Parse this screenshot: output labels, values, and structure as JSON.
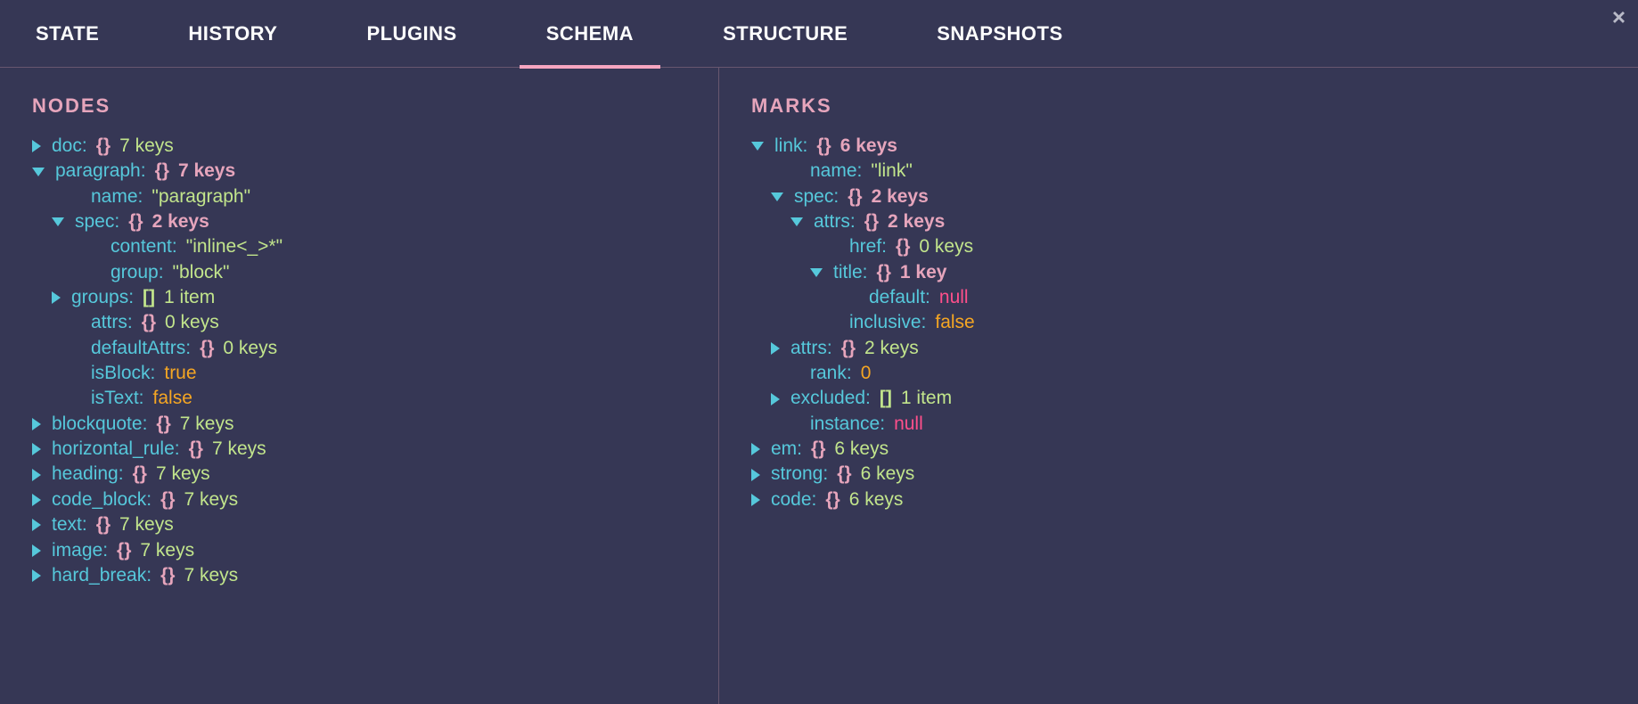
{
  "tabs": {
    "state": "STATE",
    "history": "HISTORY",
    "plugins": "PLUGINS",
    "schema": "SCHEMA",
    "structure": "STRUCTURE",
    "snapshots": "SNAPSHOTS"
  },
  "sections": {
    "nodes_title": "NODES",
    "marks_title": "MARKS"
  },
  "nodes": {
    "doc": {
      "key": "doc:",
      "brace": "{}",
      "count": "7 keys"
    },
    "paragraph": {
      "key": "paragraph:",
      "brace": "{}",
      "count": "7 keys",
      "name_key": "name:",
      "name_val": "\"paragraph\"",
      "spec": {
        "key": "spec:",
        "brace": "{}",
        "count": "2 keys",
        "content_key": "content:",
        "content_val": "\"inline<_>*\"",
        "group_key": "group:",
        "group_val": "\"block\""
      },
      "groups": {
        "key": "groups:",
        "bracket": "[]",
        "count": "1 item"
      },
      "attrs": {
        "key": "attrs:",
        "brace": "{}",
        "count": "0 keys"
      },
      "defaultAttrs": {
        "key": "defaultAttrs:",
        "brace": "{}",
        "count": "0 keys"
      },
      "isBlock_key": "isBlock:",
      "isBlock_val": "true",
      "isText_key": "isText:",
      "isText_val": "false"
    },
    "blockquote": {
      "key": "blockquote:",
      "brace": "{}",
      "count": "7 keys"
    },
    "horizontal_rule": {
      "key": "horizontal_rule:",
      "brace": "{}",
      "count": "7 keys"
    },
    "heading": {
      "key": "heading:",
      "brace": "{}",
      "count": "7 keys"
    },
    "code_block": {
      "key": "code_block:",
      "brace": "{}",
      "count": "7 keys"
    },
    "text": {
      "key": "text:",
      "brace": "{}",
      "count": "7 keys"
    },
    "image": {
      "key": "image:",
      "brace": "{}",
      "count": "7 keys"
    },
    "hard_break": {
      "key": "hard_break:",
      "brace": "{}",
      "count": "7 keys"
    }
  },
  "marks": {
    "link": {
      "key": "link:",
      "brace": "{}",
      "count": "6 keys",
      "name_key": "name:",
      "name_val": "\"link\"",
      "spec": {
        "key": "spec:",
        "brace": "{}",
        "count": "2 keys",
        "attrs": {
          "key": "attrs:",
          "brace": "{}",
          "count": "2 keys",
          "href": {
            "key": "href:",
            "brace": "{}",
            "count": "0 keys"
          },
          "title": {
            "key": "title:",
            "brace": "{}",
            "count": "1 key",
            "default_key": "default:",
            "default_val": "null"
          }
        },
        "inclusive_key": "inclusive:",
        "inclusive_val": "false"
      },
      "attrs_outer": {
        "key": "attrs:",
        "brace": "{}",
        "count": "2 keys"
      },
      "rank_key": "rank:",
      "rank_val": "0",
      "excluded": {
        "key": "excluded:",
        "bracket": "[]",
        "count": "1 item"
      },
      "instance_key": "instance:",
      "instance_val": "null"
    },
    "em": {
      "key": "em:",
      "brace": "{}",
      "count": "6 keys"
    },
    "strong": {
      "key": "strong:",
      "brace": "{}",
      "count": "6 keys"
    },
    "code": {
      "key": "code:",
      "brace": "{}",
      "count": "6 keys"
    }
  }
}
